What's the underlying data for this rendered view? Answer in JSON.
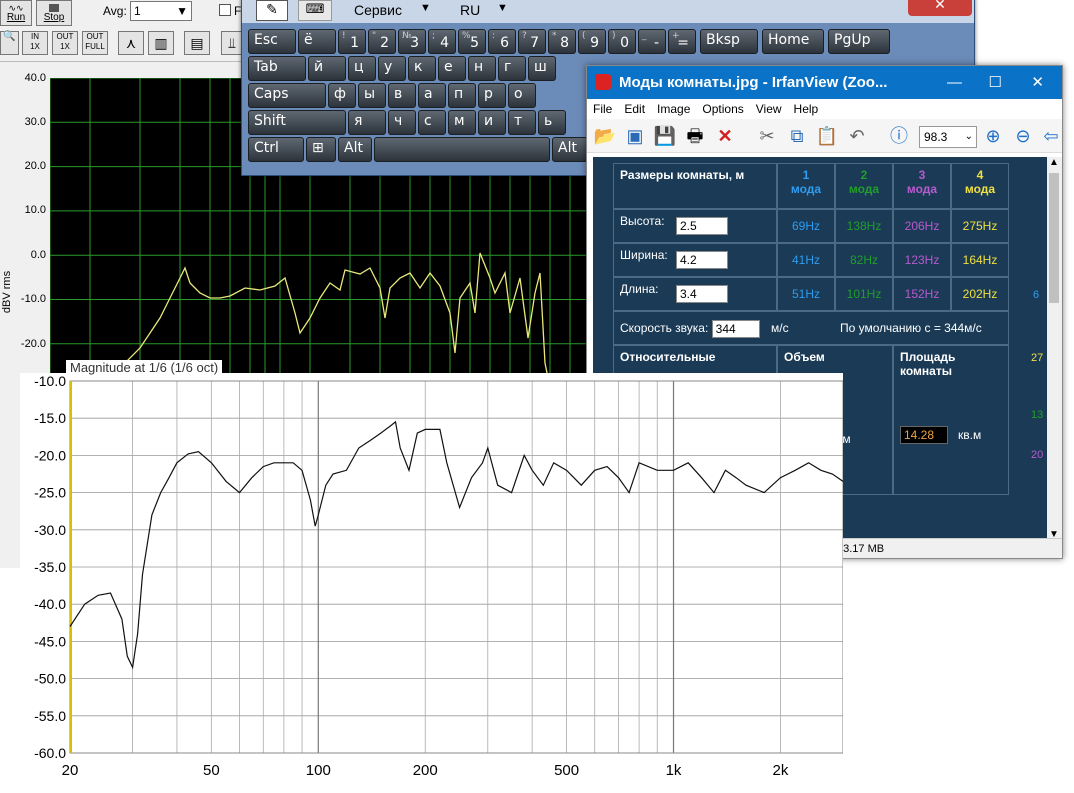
{
  "analyzer": {
    "run_label": "Run",
    "stop_label": "Stop",
    "avg_label": "Avg:",
    "avg_value": "1",
    "checkbox_label": "F",
    "tool_buttons": [
      "OUT 1X",
      "OUT 1X",
      "OUT FULL"
    ],
    "ylabel": "dBV rms",
    "y_ticks": [
      "40.0",
      "30.0",
      "20.0",
      "10.0",
      "0.0",
      "-10.0",
      "-20.0"
    ],
    "trace_color": "#e8e87a",
    "grid_color": "#2a9a2a"
  },
  "keyboard": {
    "service_label": "Сервис",
    "lang_label": "RU",
    "rows": [
      [
        {
          "main": "Esc"
        },
        {
          "main": "ё"
        },
        {
          "small": "!",
          "main": "1"
        },
        {
          "small": "\"",
          "main": "2"
        },
        {
          "small": "№",
          "main": "3"
        },
        {
          "small": ";",
          "main": "4"
        },
        {
          "small": "%",
          "main": "5"
        },
        {
          "small": ":",
          "main": "6"
        },
        {
          "small": "?",
          "main": "7"
        },
        {
          "small": "*",
          "main": "8"
        },
        {
          "small": "(",
          "main": "9"
        },
        {
          "small": ")",
          "main": "0"
        },
        {
          "small": "_",
          "main": "-"
        },
        {
          "small": "+",
          "main": "="
        },
        {
          "main": "Bksp"
        },
        {
          "main": "Home"
        },
        {
          "main": "PgUp"
        }
      ],
      [
        {
          "main": "Tab"
        },
        {
          "main": "й"
        },
        {
          "main": "ц"
        },
        {
          "main": "у"
        },
        {
          "main": "к"
        },
        {
          "main": "е"
        },
        {
          "main": "н"
        },
        {
          "main": "г"
        },
        {
          "main": "ш"
        }
      ],
      [
        {
          "main": "Caps"
        },
        {
          "main": "ф"
        },
        {
          "main": "ы"
        },
        {
          "main": "в"
        },
        {
          "main": "а"
        },
        {
          "main": "п"
        },
        {
          "main": "р"
        },
        {
          "main": "о"
        }
      ],
      [
        {
          "main": "Shift"
        },
        {
          "main": "я"
        },
        {
          "main": "ч"
        },
        {
          "main": "с"
        },
        {
          "main": "м"
        },
        {
          "main": "и"
        },
        {
          "main": "т"
        },
        {
          "main": "ь"
        }
      ],
      [
        {
          "main": "Ctrl"
        },
        {
          "main": "⊞"
        },
        {
          "main": "Alt"
        },
        {
          "main": ""
        },
        {
          "main": "Alt"
        }
      ]
    ]
  },
  "irfanview": {
    "title": "Моды комнаты.jpg - IrfanView (Zoo...",
    "menu": [
      "File",
      "Edit",
      "Image",
      "Options",
      "View",
      "Help"
    ],
    "zoom_value": "98.3",
    "status_text": "/ 3.17 MB",
    "table": {
      "header_label": "Размеры комнаты, м",
      "modes": [
        {
          "num": "1",
          "word": "мода",
          "color": "#2e9cf0"
        },
        {
          "num": "2",
          "word": "мода",
          "color": "#1f9f2a"
        },
        {
          "num": "3",
          "word": "мода",
          "color": "#b85ad0"
        },
        {
          "num": "4",
          "word": "мода",
          "color": "#f0e040"
        }
      ],
      "rows": [
        {
          "label": "Высота:",
          "value": "2.5",
          "f": [
            "69Hz",
            "138Hz",
            "206Hz",
            "275Hz"
          ]
        },
        {
          "label": "Ширина:",
          "value": "4.2",
          "f": [
            "41Hz",
            "82Hz",
            "123Hz",
            "164Hz"
          ]
        },
        {
          "label": "Длина:",
          "value": "3.4",
          "f": [
            "51Hz",
            "101Hz",
            "152Hz",
            "202Hz"
          ]
        }
      ],
      "sound_label": "Скорость звука:",
      "sound_value": "344",
      "sound_unit": "м/с",
      "default_note": "По  умолчанию с = 344м/с",
      "bottom_headers": [
        "Относительные",
        "Объем",
        "Площадь комнаты"
      ],
      "volume_unit": "уб.м",
      "area_value": "14.28",
      "area_unit": "кв.м",
      "side_values": [
        "6",
        "27",
        "13",
        "20"
      ]
    }
  },
  "front_plot": {
    "partial_title": "Magnitude at 1/6 (1/6 oct)",
    "y_ticks": [
      "-10.0",
      "-15.0",
      "-20.0",
      "-25.0",
      "-30.0",
      "-35.0",
      "-40.0",
      "-45.0",
      "-50.0",
      "-55.0",
      "-60.0"
    ],
    "x_ticks": [
      "20",
      "50",
      "100",
      "200",
      "500",
      "1k",
      "2k"
    ]
  },
  "chart_data": {
    "type": "line",
    "xlabel": "",
    "ylabel": "",
    "xscale": "log",
    "xlim": [
      20,
      3000
    ],
    "ylim": [
      -60,
      -10
    ],
    "grid": true,
    "series": [
      {
        "x": [
          20,
          22,
          24,
          26,
          28,
          29,
          30,
          31,
          32,
          34,
          36,
          38,
          40,
          43,
          46,
          50,
          55,
          60,
          65,
          70,
          75,
          80,
          85,
          90,
          95,
          98,
          100,
          105,
          110,
          120,
          130,
          140,
          150,
          160,
          165,
          170,
          180,
          190,
          200,
          210,
          220,
          230,
          250,
          270,
          290,
          300,
          320,
          350,
          380,
          400,
          430,
          460,
          500,
          550,
          600,
          650,
          700,
          750,
          800,
          900,
          1000,
          1100,
          1200,
          1300,
          1400,
          1500,
          1600,
          1800,
          2000,
          2200,
          2400,
          2600,
          2800,
          3000
        ],
        "y": [
          -43,
          -40,
          -38.8,
          -38.5,
          -42,
          -47,
          -48.5,
          -44,
          -36,
          -28,
          -25,
          -23,
          -21,
          -19.8,
          -19.5,
          -21,
          -23.5,
          -25,
          -23,
          -21.5,
          -21,
          -21,
          -21,
          -22,
          -26,
          -29.5,
          -28,
          -24,
          -22.5,
          -22,
          -19,
          -18,
          -17,
          -16,
          -15.5,
          -19,
          -22,
          -17,
          -16.5,
          -16.5,
          -16.5,
          -21,
          -27,
          -23,
          -21,
          -19,
          -24,
          -25,
          -20,
          -22,
          -24,
          -21,
          -22,
          -24,
          -22,
          -21.5,
          -23,
          -25,
          -21,
          -22,
          -22,
          -21,
          -23,
          -25,
          -22,
          -23,
          -24,
          -25,
          -23,
          -22,
          -21,
          -22,
          -22.5,
          -23.5
        ]
      }
    ]
  }
}
